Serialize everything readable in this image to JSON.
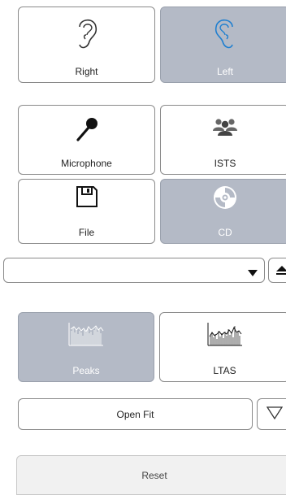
{
  "ear": {
    "right_label": "Right",
    "left_label": "Left",
    "selected": "Left"
  },
  "source": {
    "microphone_label": "Microphone",
    "ists_label": "ISTS",
    "file_label": "File",
    "cd_label": "CD",
    "selected": "CD"
  },
  "dropdown": {
    "value": ""
  },
  "view": {
    "peaks_label": "Peaks",
    "ltas_label": "LTAS",
    "selected": "Peaks"
  },
  "actions": {
    "open_fit_label": "Open Fit",
    "reset_label": "Reset"
  },
  "colors": {
    "selected_bg": "#b4bac6",
    "border": "#8a8a8a",
    "icon_dark": "#222222"
  }
}
